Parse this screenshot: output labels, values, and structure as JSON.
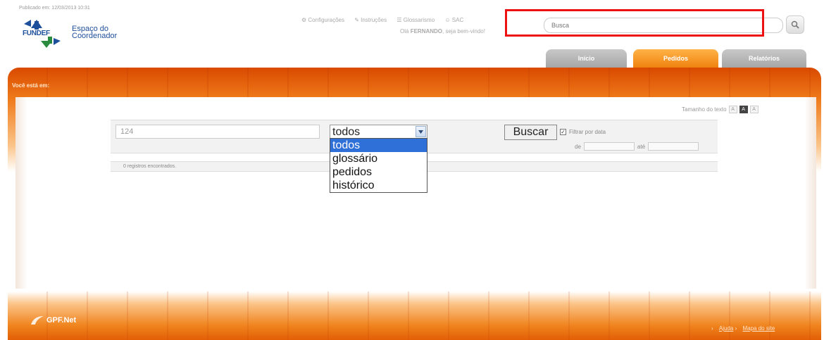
{
  "header": {
    "published": "Publicado em: 12/03/2013 10:31",
    "logo_text": "FUNDEF",
    "subtitle_line1": "Espaço do",
    "subtitle_line2": "Coordenador",
    "links": [
      "Configurações",
      "Instruções",
      "Glossarismo",
      "SAC"
    ],
    "greeting_prefix": "Olá",
    "greeting_name": "FERNANDO",
    "greeting_suffix": ", seja bem-vindo!",
    "search_placeholder": "Busca",
    "highlight_color": "#e11111"
  },
  "tabs": [
    {
      "label": "Início",
      "active": false
    },
    {
      "label": "Pedidos",
      "active": true
    },
    {
      "label": "Relatórios",
      "active": false
    }
  ],
  "breadcrumb": "Você está em:",
  "text_size": {
    "label": "Tamanho do texto",
    "options": [
      "A",
      "A",
      "A"
    ],
    "active_index": 1
  },
  "search_form": {
    "query_value": "124",
    "select_value": "todos",
    "options": [
      "todos",
      "glossário",
      "pedidos",
      "histórico"
    ],
    "selected_option": "todos",
    "submit_label": "Buscar",
    "date_filter_label": "Filtrar por data",
    "date_filter_checked": true,
    "from_label": "de",
    "to_label": "até",
    "from_placeholder": "",
    "to_placeholder": ""
  },
  "results_text": "0 registros encontrados.",
  "footer": {
    "logo_text": "GPF.Net",
    "links": [
      "Ajuda",
      "Mapa do site"
    ]
  }
}
